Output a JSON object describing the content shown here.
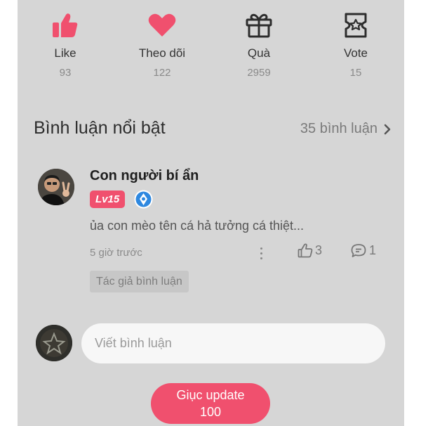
{
  "stats": [
    {
      "label": "Like",
      "count": "93",
      "icon": "thumbs-up-icon"
    },
    {
      "label": "Theo dõi",
      "count": "122",
      "icon": "heart-icon"
    },
    {
      "label": "Quà",
      "count": "2959",
      "icon": "gift-icon"
    },
    {
      "label": "Vote",
      "count": "15",
      "icon": "ticket-star-icon"
    }
  ],
  "comments_section": {
    "title": "Bình luận nổi bật",
    "link": "35 bình luận"
  },
  "comment": {
    "username": "Con người bí ẩn",
    "level": "Lv15",
    "text": "ủa con mèo tên cá hả tưởng cá thiệt...",
    "time": "5 giờ trước",
    "likes": "3",
    "replies": "1",
    "author_tag": "Tác giả bình luận"
  },
  "composer": {
    "placeholder": "Viết bình luận"
  },
  "update_button": {
    "label": "Giục update",
    "count": "100"
  },
  "colors": {
    "accent": "#f0506e",
    "panel_bg": "#d6d6d6",
    "input_bg": "#f7f7f7"
  }
}
